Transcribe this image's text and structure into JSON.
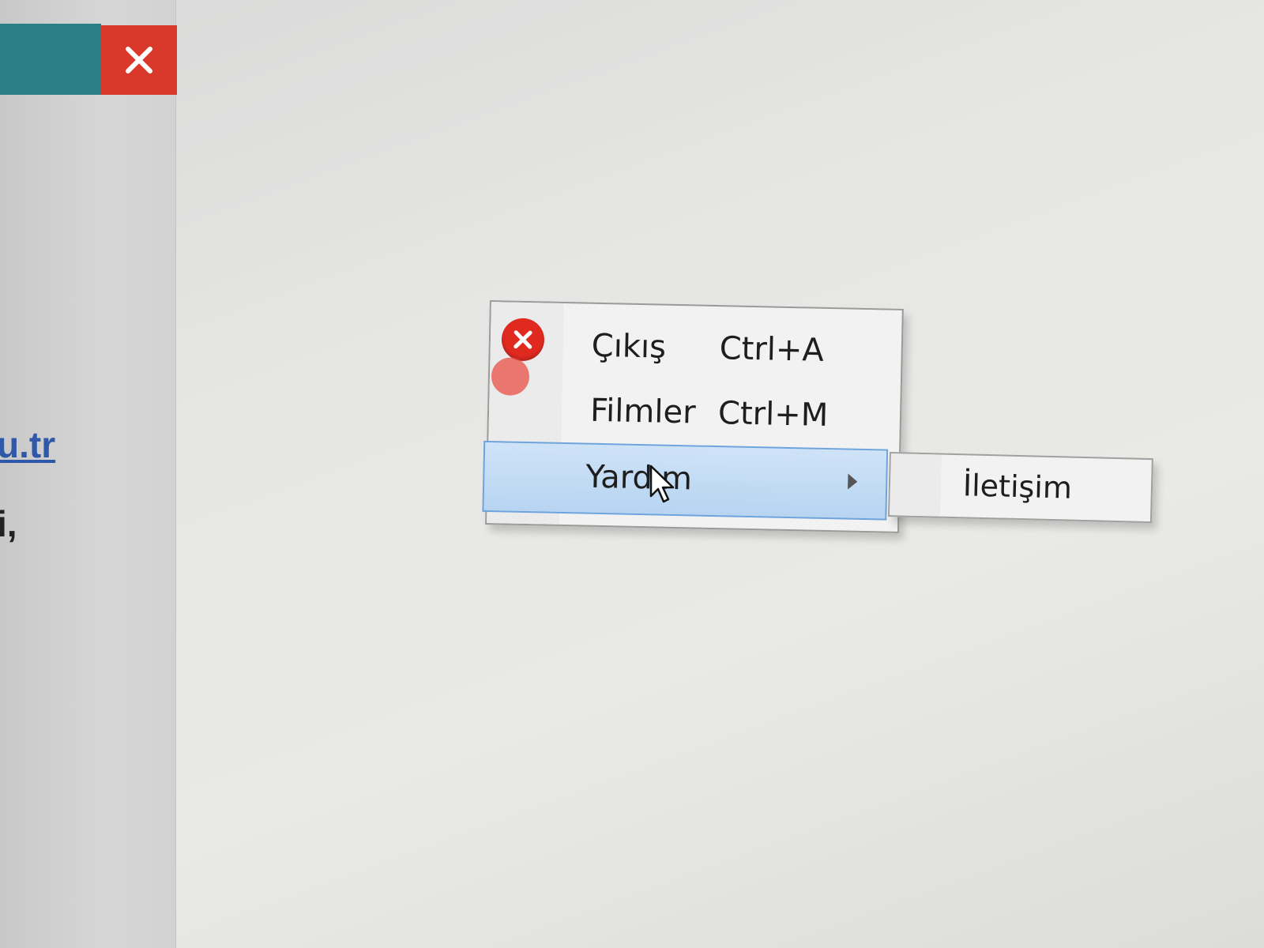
{
  "window": {
    "close_icon": "close-icon",
    "close_color": "#d9382b",
    "titlebar_color": "#2a7f86"
  },
  "background_page": {
    "link_fragment": "u.tr",
    "text_fragment": "i,"
  },
  "context_menu": {
    "items": [
      {
        "label": "Çıkış",
        "shortcut": "Ctrl+A",
        "icon": "exit-icon"
      },
      {
        "label": "Filmler",
        "shortcut": "Ctrl+M"
      },
      {
        "label": "Yardım",
        "has_submenu": true,
        "highlighted": true
      }
    ],
    "highlight_color": "#b7d4f1"
  },
  "submenu": {
    "items": [
      {
        "label": "İletişim"
      }
    ]
  }
}
